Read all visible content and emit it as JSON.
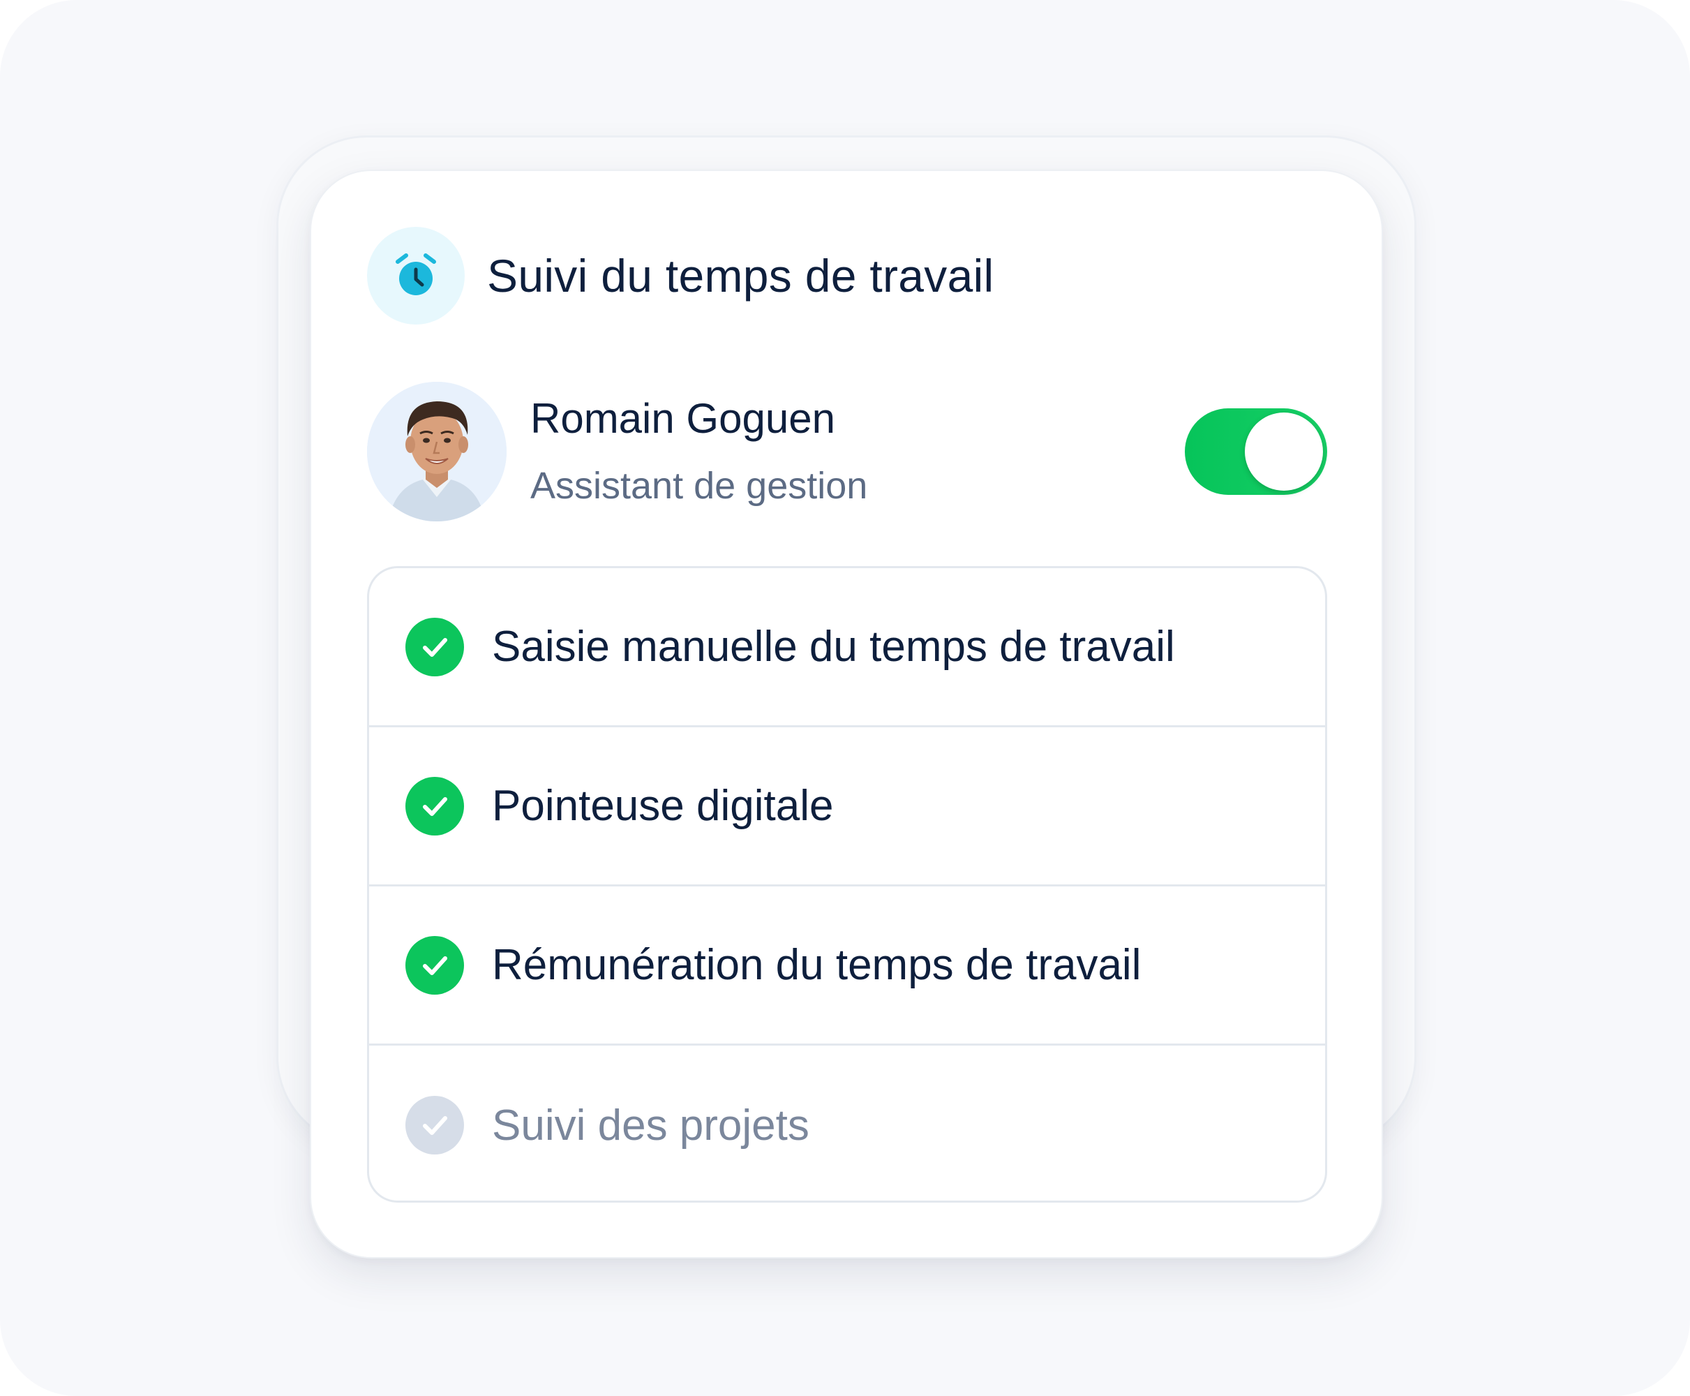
{
  "panel": {
    "title": "Suivi du temps de travail",
    "icon": "alarm-clock-icon",
    "accent_color": "#1cb8dc"
  },
  "user": {
    "name": "Romain Goguen",
    "role": "Assistant de gestion",
    "tracking_enabled": true,
    "toggle_color": "#0cc55c"
  },
  "features": [
    {
      "label": "Saisie manuelle du temps de travail",
      "enabled": true
    },
    {
      "label": "Pointeuse digitale",
      "enabled": true
    },
    {
      "label": "Rémunération du temps de travail",
      "enabled": true
    },
    {
      "label": "Suivi des projets",
      "enabled": false
    }
  ]
}
